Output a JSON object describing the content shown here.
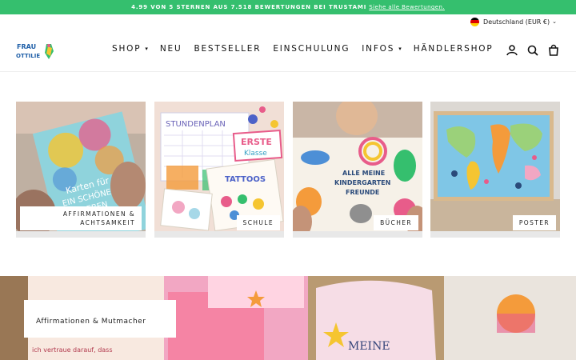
{
  "announcement": {
    "text": "4.99 VON 5 STERNEN AUS 7.518 BEWERTUNGEN BEI TRUSTAMI",
    "link": "Siehe alle Bewertungen."
  },
  "locale": {
    "label": "Deutschland (EUR €)",
    "flag_colors": [
      "#000000",
      "#dd0000",
      "#ffce00"
    ]
  },
  "brand": {
    "logo_text_1": "FRAU",
    "logo_text_2": "OTTILIE"
  },
  "nav": [
    {
      "label": "SHOP",
      "has_dropdown": true
    },
    {
      "label": "NEU",
      "has_dropdown": false
    },
    {
      "label": "BESTSELLER",
      "has_dropdown": false
    },
    {
      "label": "EINSCHULUNG",
      "has_dropdown": false
    },
    {
      "label": "INFOS",
      "has_dropdown": true
    },
    {
      "label": "HÄNDLERSHOP",
      "has_dropdown": false
    }
  ],
  "header_icons": [
    "account-icon",
    "search-icon",
    "cart-icon"
  ],
  "collections": [
    {
      "label_1": "AFFIRMATIONEN &",
      "label_2": "ACHTSAMKEIT",
      "image_text_1": "Karten für",
      "image_text_2": "EIN SCHÖNES",
      "image_text_3": "LEBEN"
    },
    {
      "label_1": "SCHULE",
      "image_text_1": "STUNDENPLAN",
      "image_text_2": "ERSTE",
      "image_text_3": "Klasse",
      "image_text_4": "TATTOOS"
    },
    {
      "label_1": "BÜCHER",
      "image_text_1": "ALLE MEINE",
      "image_text_2": "KINDERGARTEN",
      "image_text_3": "FREUNDE"
    },
    {
      "label_1": "POSTER"
    }
  ],
  "hero": {
    "heading": "Affirmationen & Mutmacher",
    "card_text_1": "ich vertraue darauf, dass",
    "card_text_2": "MEINE"
  },
  "colors": {
    "announcement_bg": "#35bf6e",
    "text": "#1a1a1a"
  }
}
